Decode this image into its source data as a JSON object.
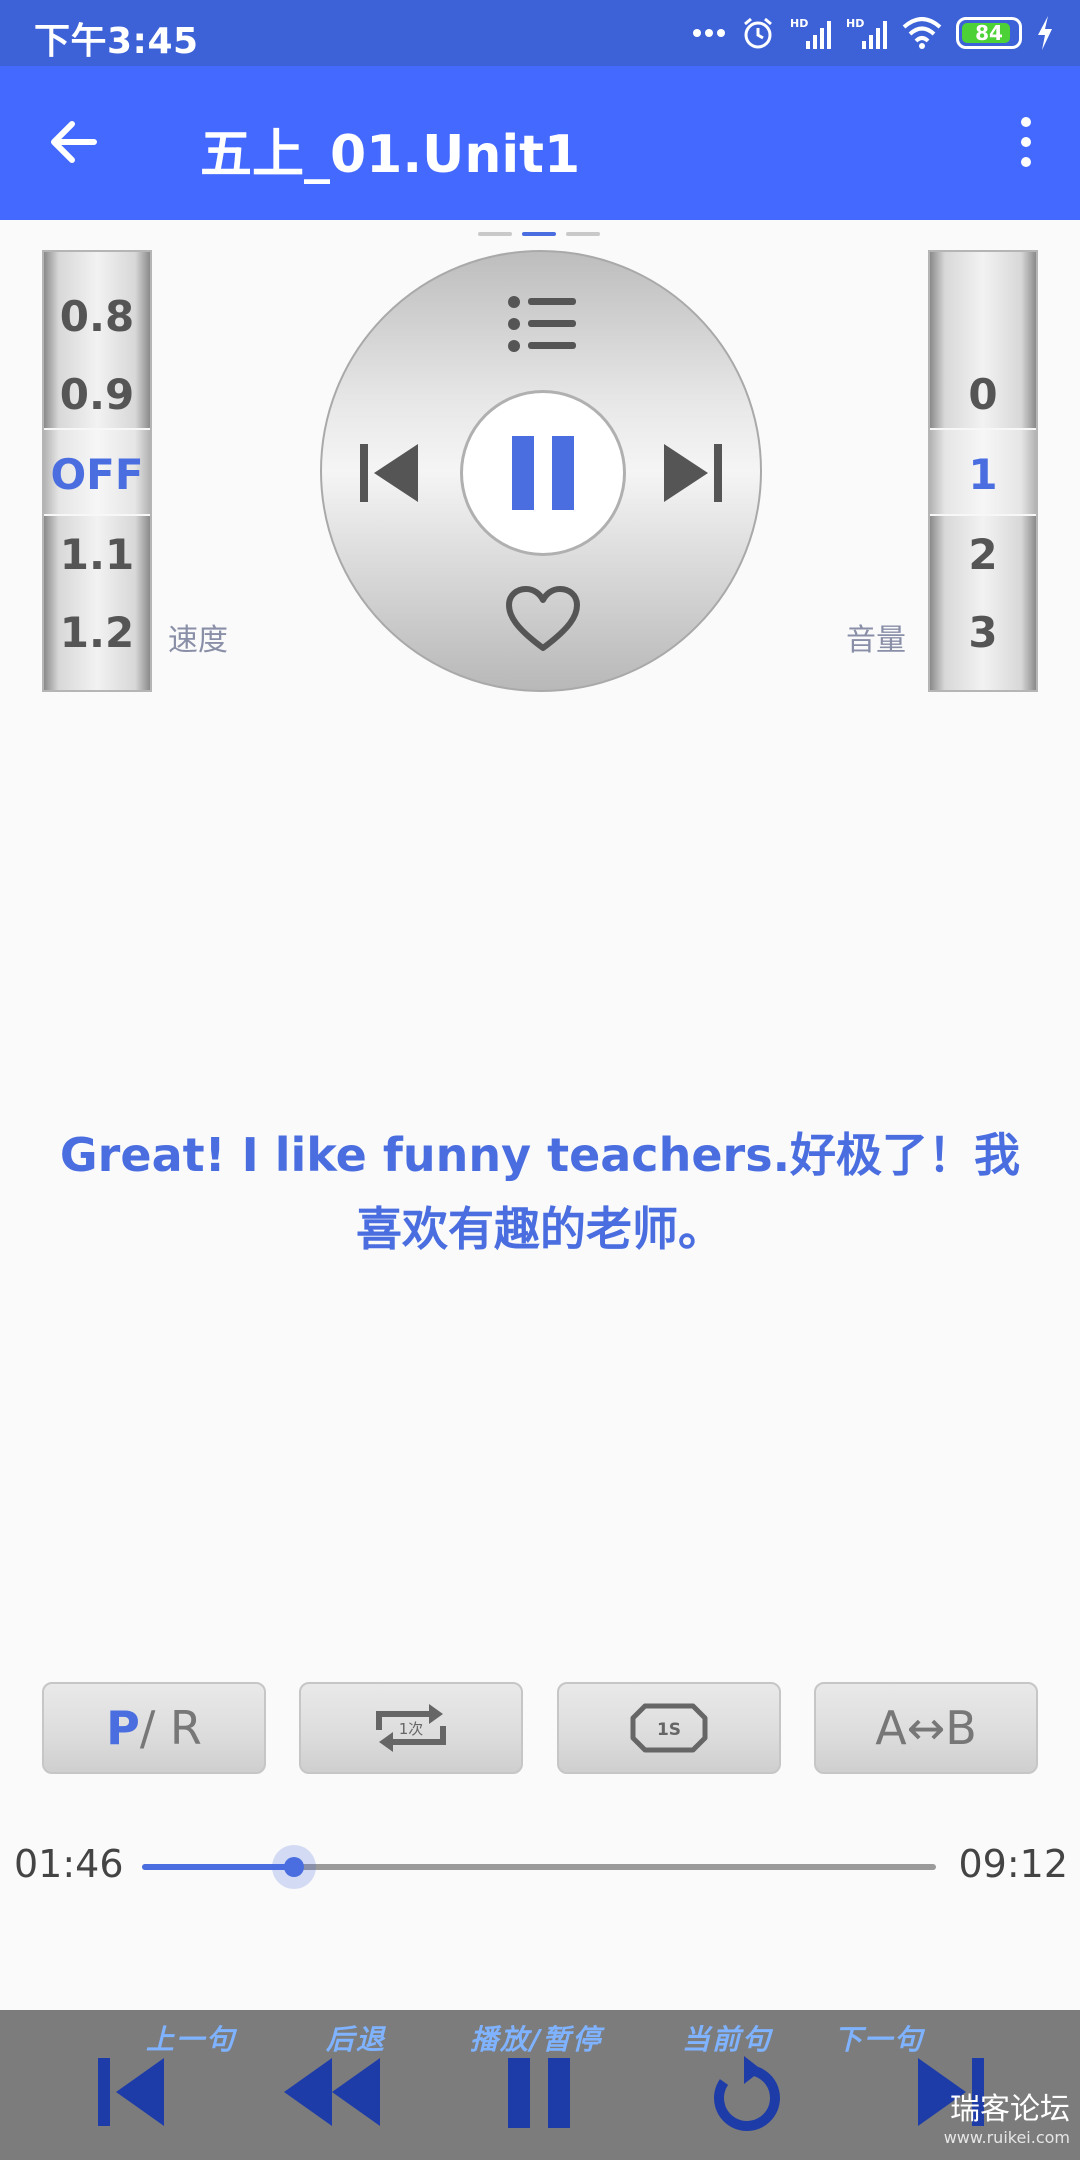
{
  "status_bar": {
    "time": "下午3:45",
    "battery": "84",
    "icons": [
      "more-dots-icon",
      "alarm-icon",
      "signal-hd-icon",
      "signal-hd-icon",
      "wifi-icon",
      "battery-icon",
      "charging-icon"
    ]
  },
  "app_bar": {
    "title": "五上_01.Unit1",
    "color": "#4469ff"
  },
  "speed_wheel": {
    "label": "速度",
    "items": [
      "0.8",
      "0.9",
      "OFF",
      "1.1",
      "1.2"
    ],
    "selected": "OFF"
  },
  "volume_wheel": {
    "label": "音量",
    "items": [
      "0",
      "1",
      "2",
      "3"
    ],
    "selected": "1"
  },
  "lyric": {
    "text": "Great! I like funny teachers.好极了！我喜欢有趣的老师。"
  },
  "modes": {
    "pr_p": "P",
    "pr_rest": " / R",
    "repeat_count": "1次",
    "interval": "1S",
    "ab": "A↔B"
  },
  "progress": {
    "current": "01:46",
    "total": "09:12",
    "fraction": 0.192
  },
  "bottom_bar": {
    "prev_sentence": "上一句",
    "rewind": "后退",
    "play_pause": "播放/暂停",
    "current_sentence": "当前句",
    "next_sentence": "下一句"
  },
  "watermark": {
    "text": "瑞客论坛",
    "sub": "www.ruikei.com"
  },
  "colors": {
    "accent": "#4a6ee0",
    "status_bar": "#3d62d8",
    "bottom_icon": "#1e3ca8"
  }
}
